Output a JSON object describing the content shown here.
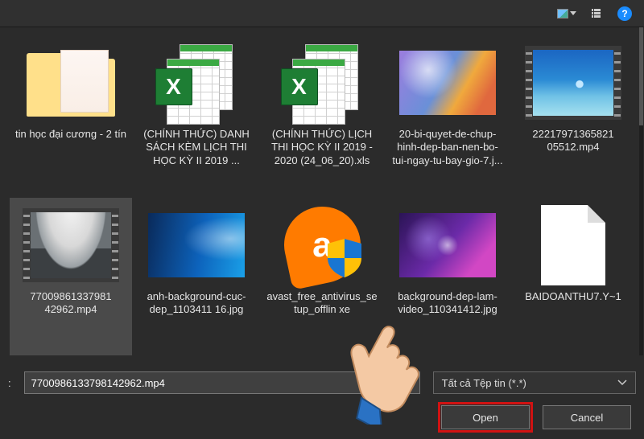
{
  "toolbar": {
    "help_glyph": "?"
  },
  "files": [
    {
      "label": "tin học đại cương - 2 tín"
    },
    {
      "label": "(CHÍNH THỨC) DANH SÁCH KÈM LỊCH THI HỌC KỲ II 2019 ..."
    },
    {
      "label": "(CHÍNH THỨC) LỊCH THI HỌC KỲ II 2019 - 2020 (24_06_20).xls"
    },
    {
      "label": "20-bi-quyet-de-chup-hinh-dep-ban-nen-bo-tui-ngay-tu-bay-gio-7.j..."
    },
    {
      "label": "22217971365821\n05512.mp4"
    },
    {
      "label": "77009861337981\n42962.mp4"
    },
    {
      "label": "anh-background-cuc-dep_1103411\n16.jpg"
    },
    {
      "label": "avast_free_antivirus_setup_offlin\nxe"
    },
    {
      "label": "background-dep-lam-video_110341412.jpg"
    },
    {
      "label": "BAIDOANTHU7.Y~1"
    }
  ],
  "bottom": {
    "filename_prefix": ":",
    "filename_value": "7700986133798142962.mp4",
    "filetype_label": "Tất cả Tệp tin (*.*)",
    "open_label": "Open",
    "cancel_label": "Cancel"
  },
  "icons": {
    "excel_letter": "X",
    "avast_letter": "a"
  }
}
